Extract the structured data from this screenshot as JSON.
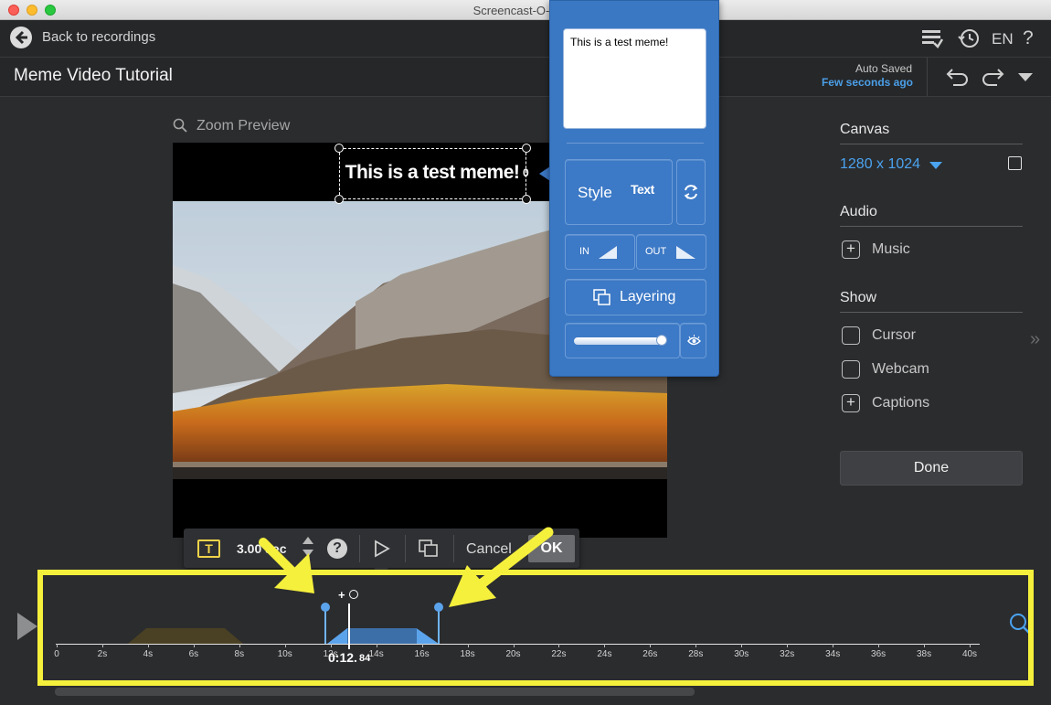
{
  "window": {
    "title": "Screencast-O-Matic"
  },
  "topbar": {
    "back_label": "Back to recordings",
    "language": "EN",
    "help": "?"
  },
  "header": {
    "project_title": "Meme Video Tutorial",
    "autosave_label": "Auto Saved",
    "autosave_time": "Few seconds ago"
  },
  "preview": {
    "zoom_label": "Zoom Preview",
    "meme_text": "This is a test meme!",
    "layer_index": "0"
  },
  "popup": {
    "text_value": "This is a test meme!",
    "style_label": "Style",
    "style_preview": "Text",
    "in_label": "IN",
    "out_label": "OUT",
    "layering_label": "Layering"
  },
  "right_panel": {
    "canvas_heading": "Canvas",
    "canvas_size": "1280 x 1024",
    "audio_heading": "Audio",
    "music_label": "Music",
    "show_heading": "Show",
    "cursor_label": "Cursor",
    "webcam_label": "Webcam",
    "captions_label": "Captions",
    "done_label": "Done"
  },
  "edit_bar": {
    "type_icon": "T",
    "duration": "3.00 sec",
    "help": "?",
    "cancel_label": "Cancel",
    "ok_label": "OK"
  },
  "timeline": {
    "ticks": [
      "0",
      "2s",
      "4s",
      "6s",
      "8s",
      "10s",
      "12s",
      "14s",
      "16s",
      "18s",
      "20s",
      "22s",
      "24s",
      "26s",
      "28s",
      "30s",
      "32s",
      "34s",
      "36s",
      "38s",
      "40s"
    ],
    "playhead_time": "0:12.",
    "playhead_ms": "84",
    "playhead_plus": "+"
  },
  "colors": {
    "accent": "#4a9fe8",
    "popup_blue": "#3b78c4",
    "highlight_yellow": "#f5f03c"
  }
}
